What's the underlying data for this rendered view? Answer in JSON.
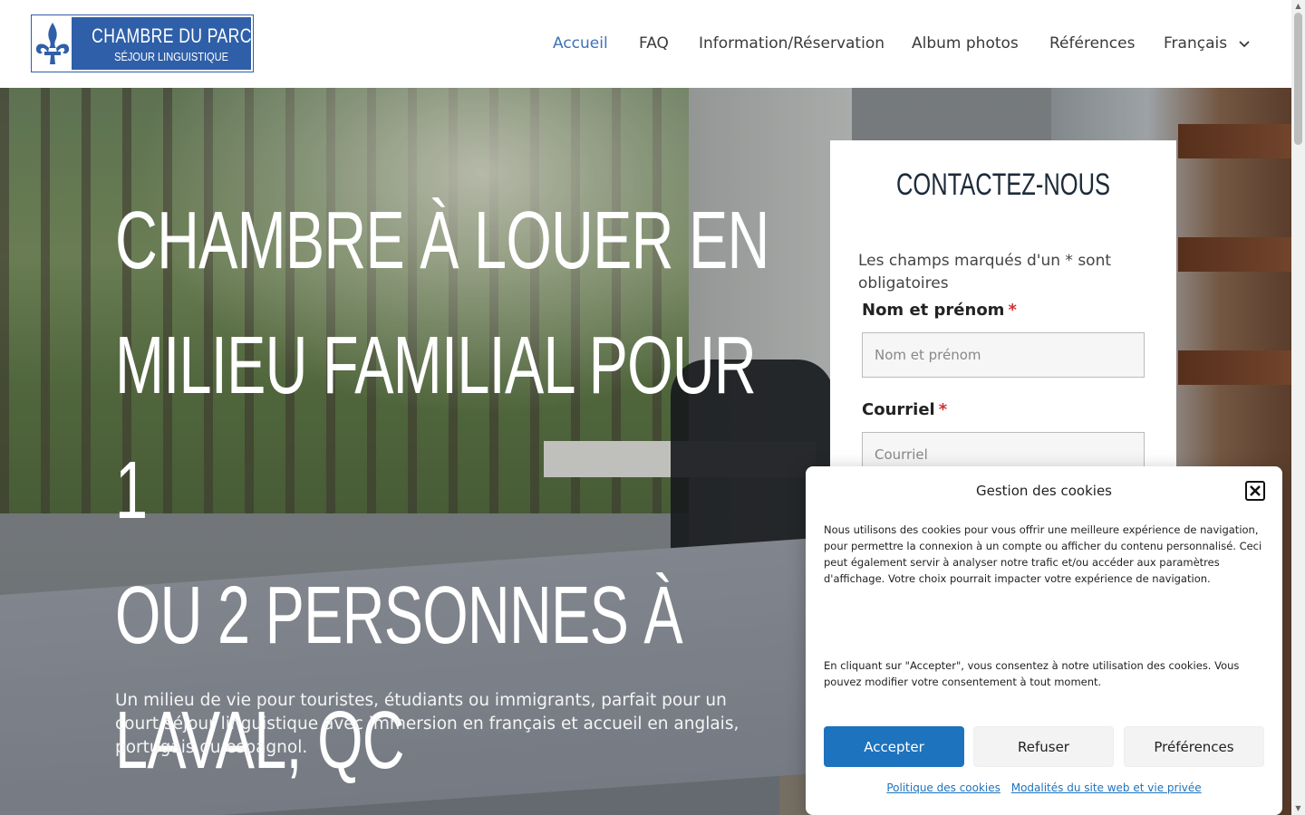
{
  "header": {
    "logo": {
      "title": "CHAMBRE DU PARC",
      "subtitle": "SÉJOUR LINGUISTIQUE",
      "icon": "fleur-de-lis-icon"
    },
    "nav": [
      {
        "label": "Accueil",
        "active": true
      },
      {
        "label": "FAQ",
        "active": false
      },
      {
        "label": "Information/Réservation",
        "active": false
      },
      {
        "label": "Album photos",
        "active": false
      },
      {
        "label": "Références",
        "active": false
      },
      {
        "label": "Français",
        "active": false,
        "icon": "chevron-down-icon"
      }
    ]
  },
  "hero": {
    "title_lines": [
      "CHAMBRE À LOUER EN",
      "MILIEU FAMILIAL POUR 1",
      "OU 2 PERSONNES À",
      "LAVAL, QC"
    ],
    "subtitle": "Un milieu de vie pour touristes, étudiants ou immigrants, parfait pour un court séjour linguistique avec immersion en français et accueil en anglais, portugais ou espagnol."
  },
  "contact": {
    "title": "CONTACTEZ-NOUS",
    "required_note": "Les champs marqués d'un * sont obligatoires",
    "fields": [
      {
        "label": "Nom et prénom",
        "required_mark": "*",
        "placeholder": "Nom et prénom",
        "value": ""
      },
      {
        "label": "Courriel",
        "required_mark": "*",
        "placeholder": "Courriel",
        "value": ""
      }
    ]
  },
  "cookie_banner": {
    "title": "Gestion des cookies",
    "text1": "Nous utilisons des cookies pour vous offrir une meilleure expérience de navigation, pour permettre la connexion à un compte ou afficher du contenu personnalisé. Ceci peut également servir à analyser notre trafic et/ou accéder aux paramètres d'affichage. Votre choix pourrait impacter votre expérience de navigation.",
    "text2": "En cliquant sur \"Accepter\", vous consentez à notre utilisation des cookies. Vous pouvez modifier votre consentement à tout moment.",
    "accept_label": "Accepter",
    "refuse_label": "Refuser",
    "preferences_label": "Préférences",
    "links": [
      "Politique des cookies",
      "Modalités du site web et vie privée"
    ]
  },
  "colors": {
    "brand_blue": "#2f5fa8",
    "nav_active": "#3d72b8",
    "accept_button": "#1e73be",
    "required_star": "#d03232"
  }
}
